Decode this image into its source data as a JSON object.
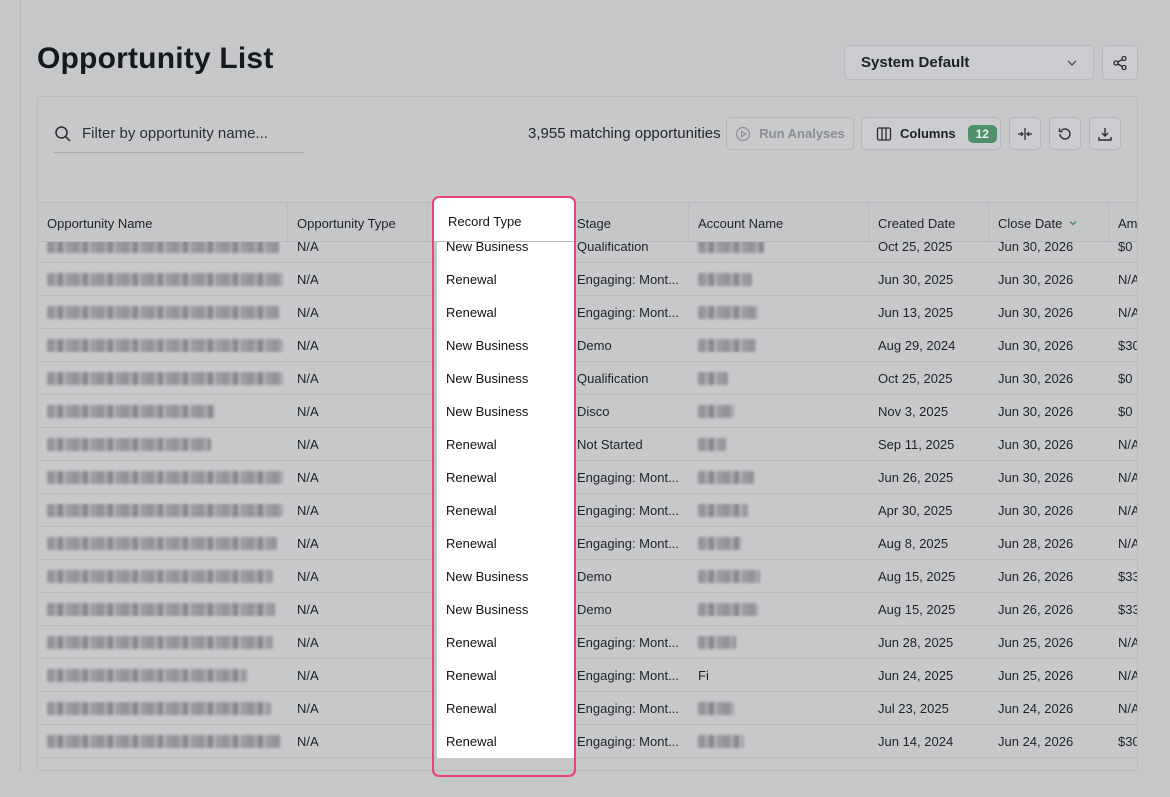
{
  "page": {
    "title": "Opportunity List"
  },
  "view_select": {
    "value": "System Default"
  },
  "search": {
    "placeholder": "Filter by opportunity name..."
  },
  "toolbar": {
    "match_count": "3,955 matching opportunities",
    "run_label": "Run Analyses",
    "columns_label": "Columns",
    "columns_count": "12"
  },
  "table": {
    "headers": {
      "name": "Opportunity Name",
      "type": "Opportunity Type",
      "record": "Record Type",
      "stage": "Stage",
      "account": "Account Name",
      "created": "Created Date",
      "close": "Close Date",
      "amount": "Am"
    },
    "rows": [
      {
        "type": "N/A",
        "record": "New Business",
        "stage": "Qualification",
        "account": "",
        "created": "Oct 25, 2025",
        "close": "Jun 30, 2026",
        "amount": "$0"
      },
      {
        "type": "N/A",
        "record": "Renewal",
        "stage": "Engaging: Mont...",
        "account": "",
        "created": "Jun 30, 2025",
        "close": "Jun 30, 2026",
        "amount": "N/A"
      },
      {
        "type": "N/A",
        "record": "Renewal",
        "stage": "Engaging: Mont...",
        "account": "",
        "created": "Jun 13, 2025",
        "close": "Jun 30, 2026",
        "amount": "N/A"
      },
      {
        "type": "N/A",
        "record": "New Business",
        "stage": "Demo",
        "account": "",
        "created": "Aug 29, 2024",
        "close": "Jun 30, 2026",
        "amount": "$30"
      },
      {
        "type": "N/A",
        "record": "New Business",
        "stage": "Qualification",
        "account": "",
        "created": "Oct 25, 2025",
        "close": "Jun 30, 2026",
        "amount": "$0"
      },
      {
        "type": "N/A",
        "record": "New Business",
        "stage": "Disco",
        "account": "",
        "created": "Nov 3, 2025",
        "close": "Jun 30, 2026",
        "amount": "$0"
      },
      {
        "type": "N/A",
        "record": "Renewal",
        "stage": "Not Started",
        "account": "",
        "created": "Sep 11, 2025",
        "close": "Jun 30, 2026",
        "amount": "N/A"
      },
      {
        "type": "N/A",
        "record": "Renewal",
        "stage": "Engaging: Mont...",
        "account": "",
        "created": "Jun 26, 2025",
        "close": "Jun 30, 2026",
        "amount": "N/A"
      },
      {
        "type": "N/A",
        "record": "Renewal",
        "stage": "Engaging: Mont...",
        "account": "",
        "created": "Apr 30, 2025",
        "close": "Jun 30, 2026",
        "amount": "N/A"
      },
      {
        "type": "N/A",
        "record": "Renewal",
        "stage": "Engaging: Mont...",
        "account": "",
        "created": "Aug 8, 2025",
        "close": "Jun 28, 2026",
        "amount": "N/A"
      },
      {
        "type": "N/A",
        "record": "New Business",
        "stage": "Demo",
        "account": "",
        "created": "Aug 15, 2025",
        "close": "Jun 26, 2026",
        "amount": "$33"
      },
      {
        "type": "N/A",
        "record": "New Business",
        "stage": "Demo",
        "account": "",
        "created": "Aug 15, 2025",
        "close": "Jun 26, 2026",
        "amount": "$33"
      },
      {
        "type": "N/A",
        "record": "Renewal",
        "stage": "Engaging: Mont...",
        "account": "",
        "created": "Jun 28, 2025",
        "close": "Jun 25, 2026",
        "amount": "N/A"
      },
      {
        "type": "N/A",
        "record": "Renewal",
        "stage": "Engaging: Mont...",
        "account": "Fi",
        "created": "Jun 24, 2025",
        "close": "Jun 25, 2026",
        "amount": "N/A"
      },
      {
        "type": "N/A",
        "record": "Renewal",
        "stage": "Engaging: Mont...",
        "account": "",
        "created": "Jul 23, 2025",
        "close": "Jun 24, 2026",
        "amount": "N/A"
      },
      {
        "type": "N/A",
        "record": "Renewal",
        "stage": "Engaging: Mont...",
        "account": "",
        "created": "Jun 14, 2024",
        "close": "Jun 24, 2026",
        "amount": "$30"
      }
    ]
  },
  "colors": {
    "highlight": "#e64576",
    "badge": "#4f8f6a",
    "background": "#c6c7c9"
  },
  "icons": [
    "search-icon",
    "chevron-down-icon",
    "share-icon",
    "play-circle-icon",
    "columns-icon",
    "resize-columns-icon",
    "refresh-icon",
    "download-icon",
    "sort-desc-icon"
  ]
}
